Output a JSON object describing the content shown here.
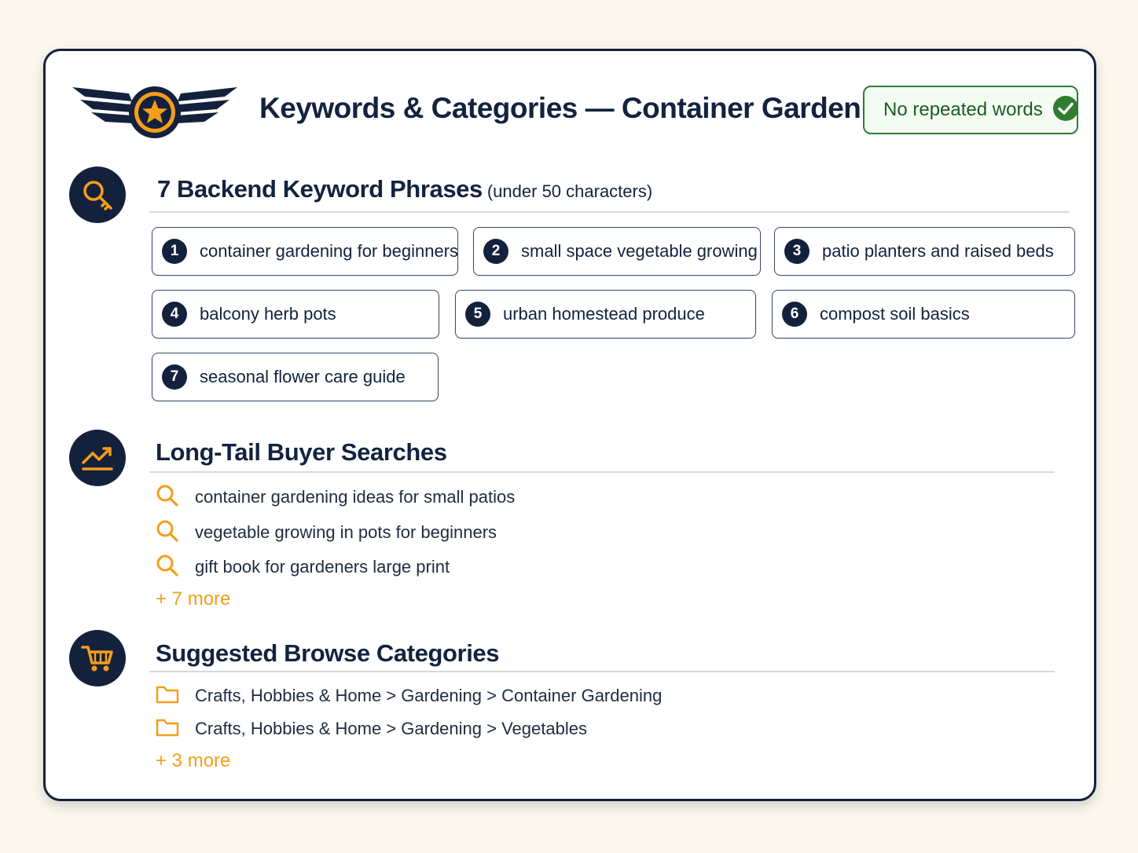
{
  "header": {
    "title": "Keywords & Categories — Container Gardening",
    "badge_text": "No repeated words",
    "badge_icon": "check-circle-icon",
    "logo_icon": "winged-star-logo"
  },
  "keywords": {
    "title": "7 Backend Keyword Phrases",
    "subtitle": "(under 50 characters)",
    "icon": "search-key-icon",
    "items": [
      {
        "num": "1",
        "text": "container gardening for beginners"
      },
      {
        "num": "2",
        "text": "small space vegetable growing"
      },
      {
        "num": "3",
        "text": "patio planters and raised beds"
      },
      {
        "num": "4",
        "text": "balcony herb pots"
      },
      {
        "num": "5",
        "text": "urban homestead produce"
      },
      {
        "num": "6",
        "text": "compost soil basics"
      },
      {
        "num": "7",
        "text": "seasonal flower care guide"
      }
    ]
  },
  "longtail": {
    "title": "Long-Tail Buyer Searches",
    "icon": "trend-up-icon",
    "items": [
      "container gardening ideas for small patios",
      "vegetable growing in pots for beginners",
      "gift book for gardeners large print"
    ],
    "more": "+ 7 more"
  },
  "categories": {
    "title": "Suggested Browse Categories",
    "icon": "cart-icon",
    "items": [
      "Crafts, Hobbies & Home > Gardening > Container Gardening",
      "Crafts, Hobbies & Home > Gardening > Vegetables"
    ],
    "more": "+ 3 more"
  },
  "colors": {
    "navy": "#14213d",
    "accent": "#f59e1a",
    "success": "#2e7d32"
  }
}
